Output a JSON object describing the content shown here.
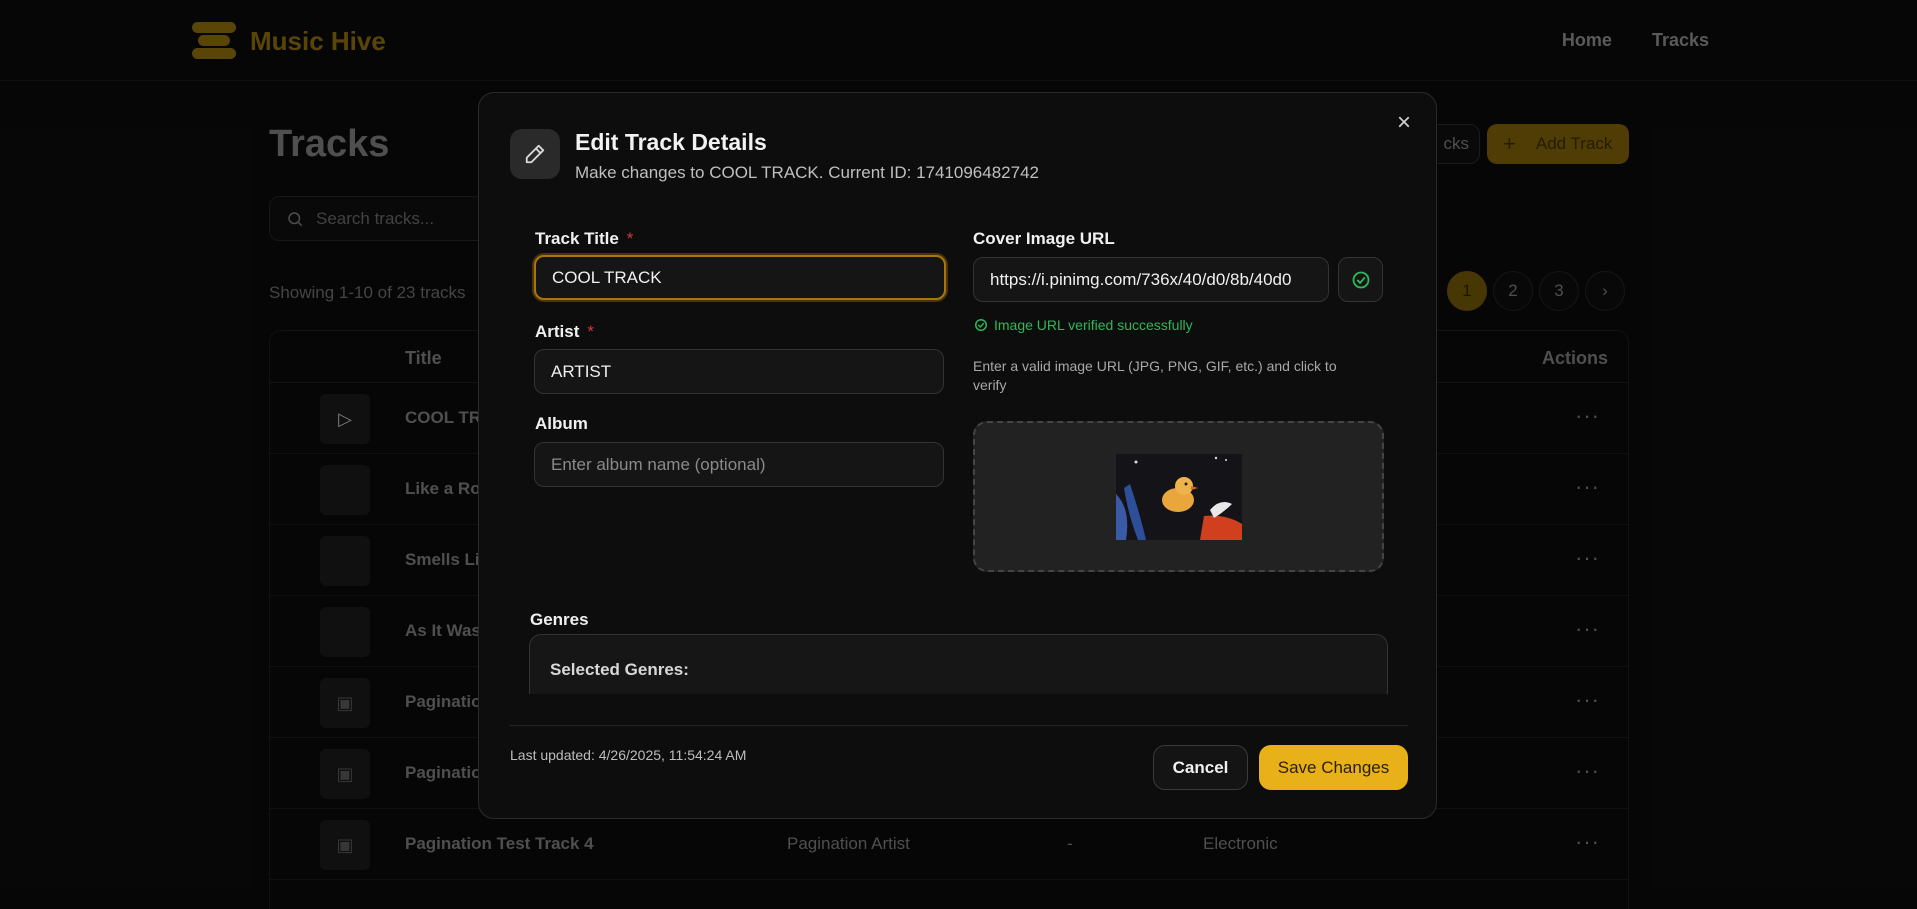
{
  "app": {
    "name": "Music Hive"
  },
  "nav": {
    "home": "Home",
    "tracks": "Tracks"
  },
  "page": {
    "title": "Tracks",
    "search_placeholder": "Search tracks...",
    "showing": "Showing 1-10 of 23 tracks",
    "tracks_button": "cks",
    "add_track": "Add Track",
    "pagination": [
      "1",
      "2",
      "3"
    ],
    "table": {
      "headers": {
        "title": "Title",
        "actions": "Actions"
      },
      "rows": [
        {
          "title": "COOL TRA",
          "artist": "",
          "album": "",
          "genre": "",
          "actions": "···"
        },
        {
          "title": "Like a Rol",
          "artist": "",
          "album": "",
          "genre": "",
          "actions": "···"
        },
        {
          "title": "Smells Lik",
          "artist": "",
          "album": "",
          "genre": "",
          "actions": "···"
        },
        {
          "title": "As It Was",
          "artist": "",
          "album": "",
          "genre": "",
          "actions": "···"
        },
        {
          "title": "Paginatio",
          "artist": "",
          "album": "",
          "genre": "",
          "actions": "···"
        },
        {
          "title": "Paginatio",
          "artist": "",
          "album": "",
          "genre": "",
          "actions": "···"
        },
        {
          "title": "Pagination Test Track 4",
          "artist": "Pagination Artist",
          "album": "-",
          "genre": "Electronic",
          "actions": "···"
        }
      ]
    }
  },
  "modal": {
    "title": "Edit Track Details",
    "subtitle": "Make changes to COOL TRACK. Current ID: 1741096482742",
    "close": "×",
    "fields": {
      "title_label": "Track Title",
      "title_value": "COOL TRACK",
      "artist_label": "Artist",
      "artist_value": "ARTIST",
      "album_label": "Album",
      "album_placeholder": "Enter album name (optional)",
      "cover_label": "Cover Image URL",
      "cover_value": "https://i.pinimg.com/736x/40/d0/8b/40d0",
      "verified_msg": "Image URL verified successfully",
      "cover_hint": "Enter a valid image URL (JPG, PNG, GIF, etc.) and click to verify",
      "genres_label": "Genres",
      "selected_genres": "Selected Genres:",
      "required_mark": "*"
    },
    "footer": {
      "last_updated": "Last updated: 4/26/2025, 11:54:24 AM",
      "cancel": "Cancel",
      "save": "Save Changes"
    }
  },
  "colors": {
    "accent": "#e8b11a",
    "success": "#2fb85a",
    "required": "#d43c3c"
  }
}
